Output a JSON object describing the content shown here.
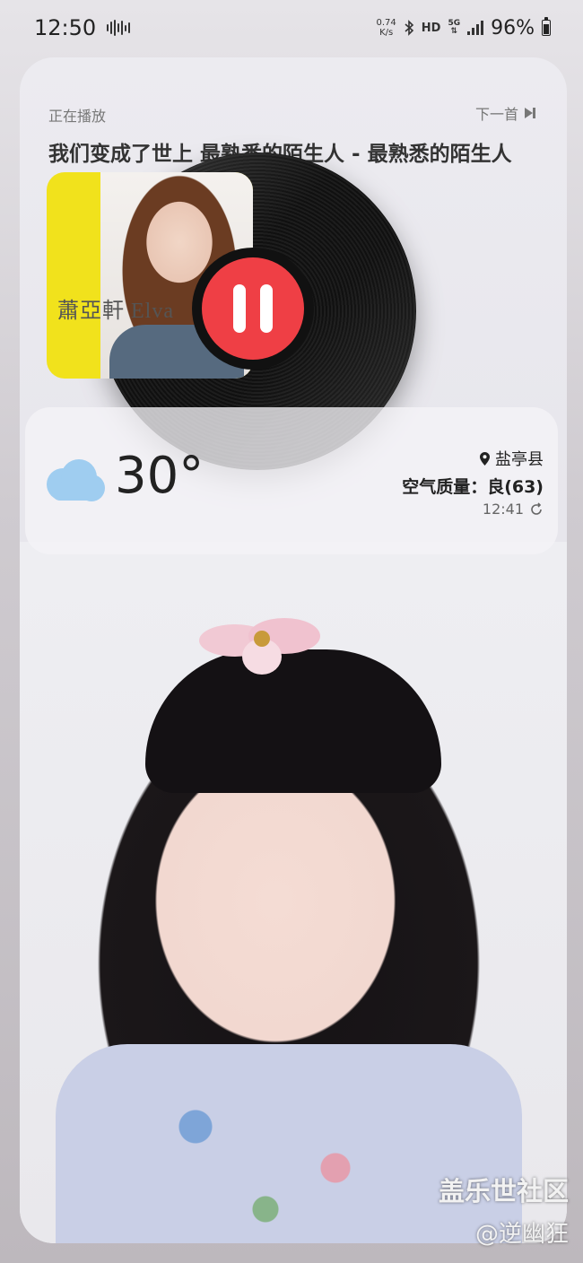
{
  "status_bar": {
    "time": "12:50",
    "net_speed_value": "0.74",
    "net_speed_unit": "K/s",
    "hd": "HD",
    "network": "5G",
    "battery": "96%"
  },
  "music": {
    "label": "正在播放",
    "next_label": "下一首",
    "title": "我们变成了世上 最熟悉的陌生人 - 最熟悉的陌生人",
    "album_art_text": "蕭亞軒 Elva",
    "state": "playing",
    "accent_color": "#ef3f45"
  },
  "weather": {
    "temperature": "30°",
    "location": "盐亭县",
    "aqi": "空气质量：良(63)",
    "updated": "12:41",
    "icon": "cloud-icon"
  },
  "watermark": {
    "site": "盖乐世社区",
    "user": "@逆幽狂"
  }
}
